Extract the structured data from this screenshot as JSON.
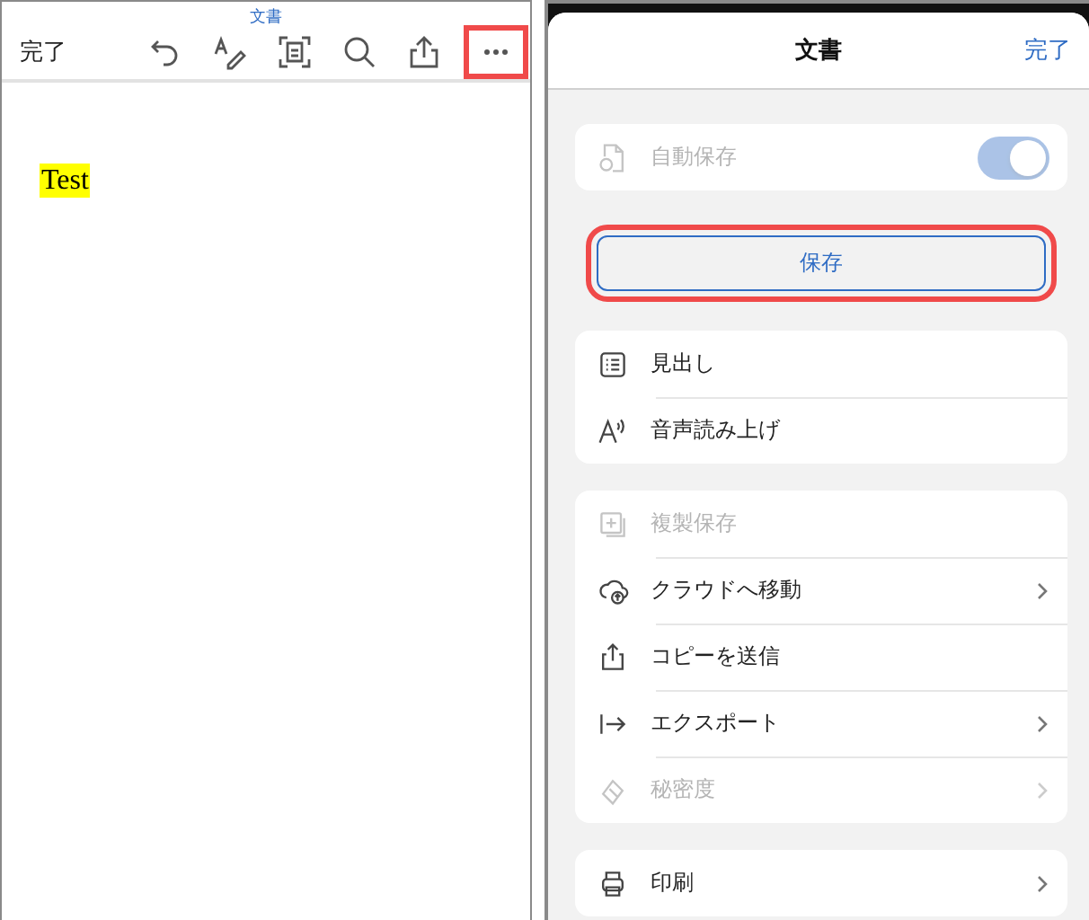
{
  "editor": {
    "title": "文書",
    "done": "完了",
    "more_highlighted": true,
    "document_text": "Test"
  },
  "menu": {
    "title": "文書",
    "done": "完了",
    "autosave": {
      "label": "自動保存",
      "on": true,
      "disabled": true
    },
    "save": {
      "label": "保存",
      "highlighted": true
    },
    "groups": [
      [
        {
          "label": "見出し",
          "disabled": false,
          "chevron": false
        },
        {
          "label": "音声読み上げ",
          "disabled": false,
          "chevron": false
        }
      ],
      [
        {
          "label": "複製保存",
          "disabled": true,
          "chevron": false
        },
        {
          "label": "クラウドへ移動",
          "disabled": false,
          "chevron": true
        },
        {
          "label": "コピーを送信",
          "disabled": false,
          "chevron": false
        },
        {
          "label": "エクスポート",
          "disabled": false,
          "chevron": true
        },
        {
          "label": "秘密度",
          "disabled": true,
          "chevron": true
        }
      ],
      [
        {
          "label": "印刷",
          "disabled": false,
          "chevron": true
        }
      ]
    ]
  }
}
